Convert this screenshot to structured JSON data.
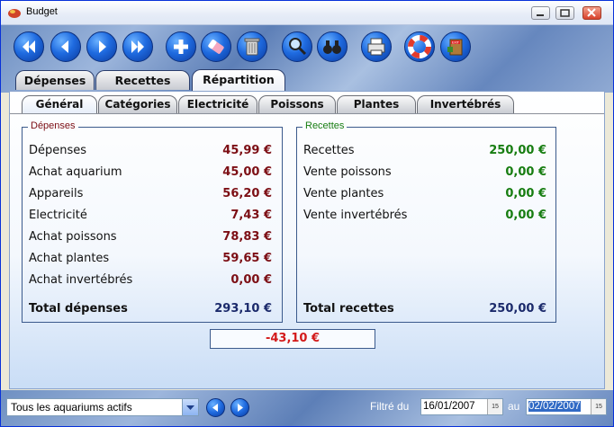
{
  "window": {
    "title": "Budget"
  },
  "toolbar": {
    "buttons": [
      "first-icon",
      "previous-icon",
      "next-icon",
      "last-icon",
      "add-icon",
      "eraser-icon",
      "trash-icon",
      "search-icon",
      "binoculars-icon",
      "printer-icon",
      "lifebuoy-icon",
      "exit-door-icon"
    ],
    "exit_sign": "EXIT"
  },
  "main_tabs": [
    "Dépenses",
    "Recettes",
    "Répartition"
  ],
  "sub_tabs": [
    "Général",
    "Catégories",
    "Electricité",
    "Poissons",
    "Plantes",
    "Invertébrés"
  ],
  "depenses": {
    "legend": "Dépenses",
    "rows": [
      {
        "label": "Dépenses",
        "value": "45,99 €"
      },
      {
        "label": "Achat aquarium",
        "value": "45,00 €"
      },
      {
        "label": "Appareils",
        "value": "56,20 €"
      },
      {
        "label": "Electricité",
        "value": "7,43 €"
      },
      {
        "label": "Achat poissons",
        "value": "78,83 €"
      },
      {
        "label": "Achat plantes",
        "value": "59,65 €"
      },
      {
        "label": "Achat invertébrés",
        "value": "0,00 €"
      }
    ],
    "total_label": "Total dépenses",
    "total_value": "293,10 €"
  },
  "recettes": {
    "legend": "Recettes",
    "rows": [
      {
        "label": "Recettes",
        "value": "250,00 €"
      },
      {
        "label": "Vente poissons",
        "value": "0,00 €"
      },
      {
        "label": "Vente plantes",
        "value": "0,00 €"
      },
      {
        "label": "Vente invertébrés",
        "value": "0,00 €"
      }
    ],
    "total_label": "Total recettes",
    "total_value": "250,00 €"
  },
  "balance": "-43,10 €",
  "status": {
    "aquarium_select": "Tous les aquariums actifs",
    "filter_label": "Filtré du",
    "date_from": "16/01/2007",
    "to_label": "au",
    "date_to": "02/02/2007",
    "cal_label": "15"
  },
  "colors": {
    "expense": "#7c0e14",
    "income": "#177d11",
    "total": "#1b2a6b",
    "balance": "#d31a1a"
  }
}
